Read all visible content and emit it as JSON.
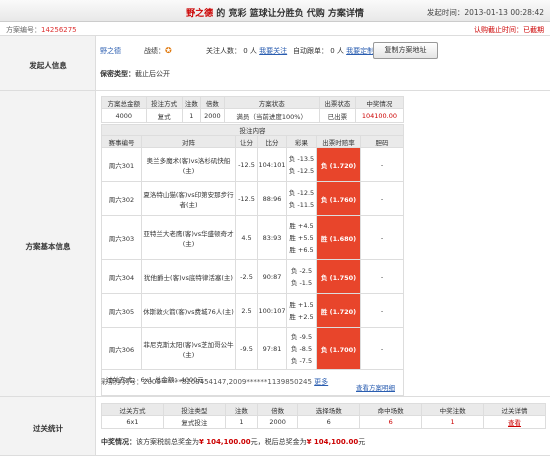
{
  "header": {
    "user": "野之德",
    "title_rest": " 的 竞彩 篮球让分胜负 代购 方案详情",
    "publish_label": "发起时间：",
    "publish_time": "2013-01-13 00:28:42"
  },
  "subheader": {
    "plan_no_label": "方案编号：",
    "plan_no": "14256275",
    "deadline_label": "认购截止时间：",
    "deadline": "已截期"
  },
  "sections": {
    "initiator": "发起人信息",
    "plan_info": "方案基本信息",
    "summary": "过关统计"
  },
  "initiator": {
    "name": "野之德",
    "record_label": "战绩：",
    "follow_text": "关注人数： 0 人",
    "follow_link": "我要关注",
    "auto_text": "自动跟单： 0 人",
    "auto_link": "我要定制",
    "copy_button": "复制方案地址",
    "privacy_label": "保密类型：",
    "privacy_value": "截止后公开"
  },
  "plan_table": {
    "headers": [
      "方案总金额",
      "投注方式",
      "注数",
      "倍数",
      "方案状态",
      "出票状态",
      "中奖情况"
    ],
    "row": [
      "4000",
      "复式",
      "1",
      "2000",
      "满员（当前进度100%）",
      "已出票",
      "104100.00"
    ]
  },
  "bets": {
    "section_title": "投注内容",
    "headers": [
      "赛事编号",
      "对阵",
      "让分",
      "比分",
      "彩果",
      "出票时赔率",
      "胆码"
    ],
    "rows": [
      {
        "no": "周六301",
        "match": "奥兰多魔术(客)vs洛杉矶快船(主)",
        "handicap": "-12.5",
        "score": "104:101",
        "results": [
          "负 -13.5",
          "负 -12.5"
        ],
        "odds": "负 (1.720)",
        "banker": "-"
      },
      {
        "no": "周六302",
        "match": "夏洛特山猫(客)vs印第安那步行者(主)",
        "handicap": "-12.5",
        "score": "88:96",
        "results": [
          "负 -12.5",
          "负 -11.5"
        ],
        "odds": "负 (1.760)",
        "banker": "-"
      },
      {
        "no": "周六303",
        "match": "亚特兰大老鹰(客)vs华盛顿奇才(主)",
        "handicap": "4.5",
        "score": "83:93",
        "results": [
          "胜 +4.5",
          "胜 +5.5",
          "胜 +6.5"
        ],
        "odds": "胜 (1.680)",
        "banker": "-"
      },
      {
        "no": "周六304",
        "match": "犹他爵士(客)vs底特律活塞(主)",
        "handicap": "-2.5",
        "score": "90:87",
        "results": [
          "负 -2.5",
          "负 -1.5"
        ],
        "odds": "负 (1.750)",
        "banker": "-"
      },
      {
        "no": "周六305",
        "match": "休斯敦火箭(客)vs费城76人(主)",
        "handicap": "2.5",
        "score": "100:107",
        "results": [
          "胜 +1.5",
          "胜 +2.5"
        ],
        "odds": "胜 (1.720)",
        "banker": "-"
      },
      {
        "no": "周六306",
        "match": "菲尼克斯太阳(客)vs芝加哥公牛(主)",
        "handicap": "-9.5",
        "score": "97:81",
        "results": [
          "负 -9.5",
          "负 -8.5",
          "负 -7.5"
        ],
        "odds": "负 (1.700)",
        "banker": "-"
      }
    ],
    "footer_text": "过关方式： 6x1 总金额：4000元",
    "footer_link": "查看方案明细"
  },
  "ticket": {
    "label": "彩票序列号：",
    "value": "2009******8208454147,2009******1139850245",
    "more": "更多"
  },
  "summary": {
    "headers": [
      "过关方式",
      "投注类型",
      "注数",
      "倍数",
      "选择场数",
      "命中场数",
      "中奖注数",
      "过关详情"
    ],
    "row": [
      "6x1",
      "复式投注",
      "1",
      "2000",
      "6",
      "6",
      "1",
      "查看"
    ],
    "note_label": "中奖情况：",
    "note_text1": "该方案税前总奖金为",
    "pretax": "¥ 104,100.00",
    "note_text2": "元，税后总奖金为",
    "aftertax": "¥ 104,100.00",
    "note_text3": "元"
  }
}
